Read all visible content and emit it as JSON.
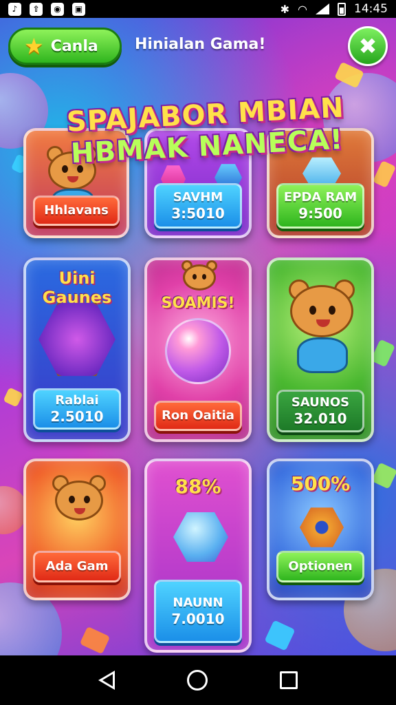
{
  "status_bar": {
    "time": "14:45",
    "icons": [
      "tiktok-icon",
      "upload-icon",
      "media-icon",
      "gallery-icon",
      "bluetooth-icon",
      "wifi-icon",
      "signal-icon",
      "battery-icon"
    ]
  },
  "header": {
    "button_label": "Canla",
    "title": "Hinialan Gama!",
    "close_symbol": "✖"
  },
  "banner": {
    "line1": "SPAJABOR MBIAN",
    "line2": "HBMAK NANECA!"
  },
  "cards": [
    {
      "id": "c1",
      "label": "Hhlavans",
      "value": ""
    },
    {
      "id": "c2",
      "label": "SAVHM",
      "value": "3:5010"
    },
    {
      "id": "c3",
      "label": "EPDA RAM",
      "value": "9:500"
    },
    {
      "id": "c4",
      "heading": "Uini Gaunes",
      "label": "Rablai",
      "value": "2.5010"
    },
    {
      "id": "c5",
      "heading": "SOAMIS!",
      "label": "Ron Oaitia",
      "value": ""
    },
    {
      "id": "c6",
      "label": "SAUNOS",
      "value": "32.010"
    },
    {
      "id": "c7",
      "label": "Ada Gam",
      "value": ""
    },
    {
      "id": "c8",
      "heading": "88%",
      "label": "NAUNN",
      "value": "7.0010"
    },
    {
      "id": "c9",
      "heading": "500%",
      "label": "Optionen",
      "value": ""
    }
  ],
  "colors": {
    "green_button": "#2fb51e",
    "red_pill": "#e02a16",
    "blue_pill": "#1b8fe8",
    "banner_yellow": "#ffe14a"
  },
  "nav_bar": {
    "icons": [
      "back-icon",
      "home-icon",
      "recents-icon"
    ]
  }
}
